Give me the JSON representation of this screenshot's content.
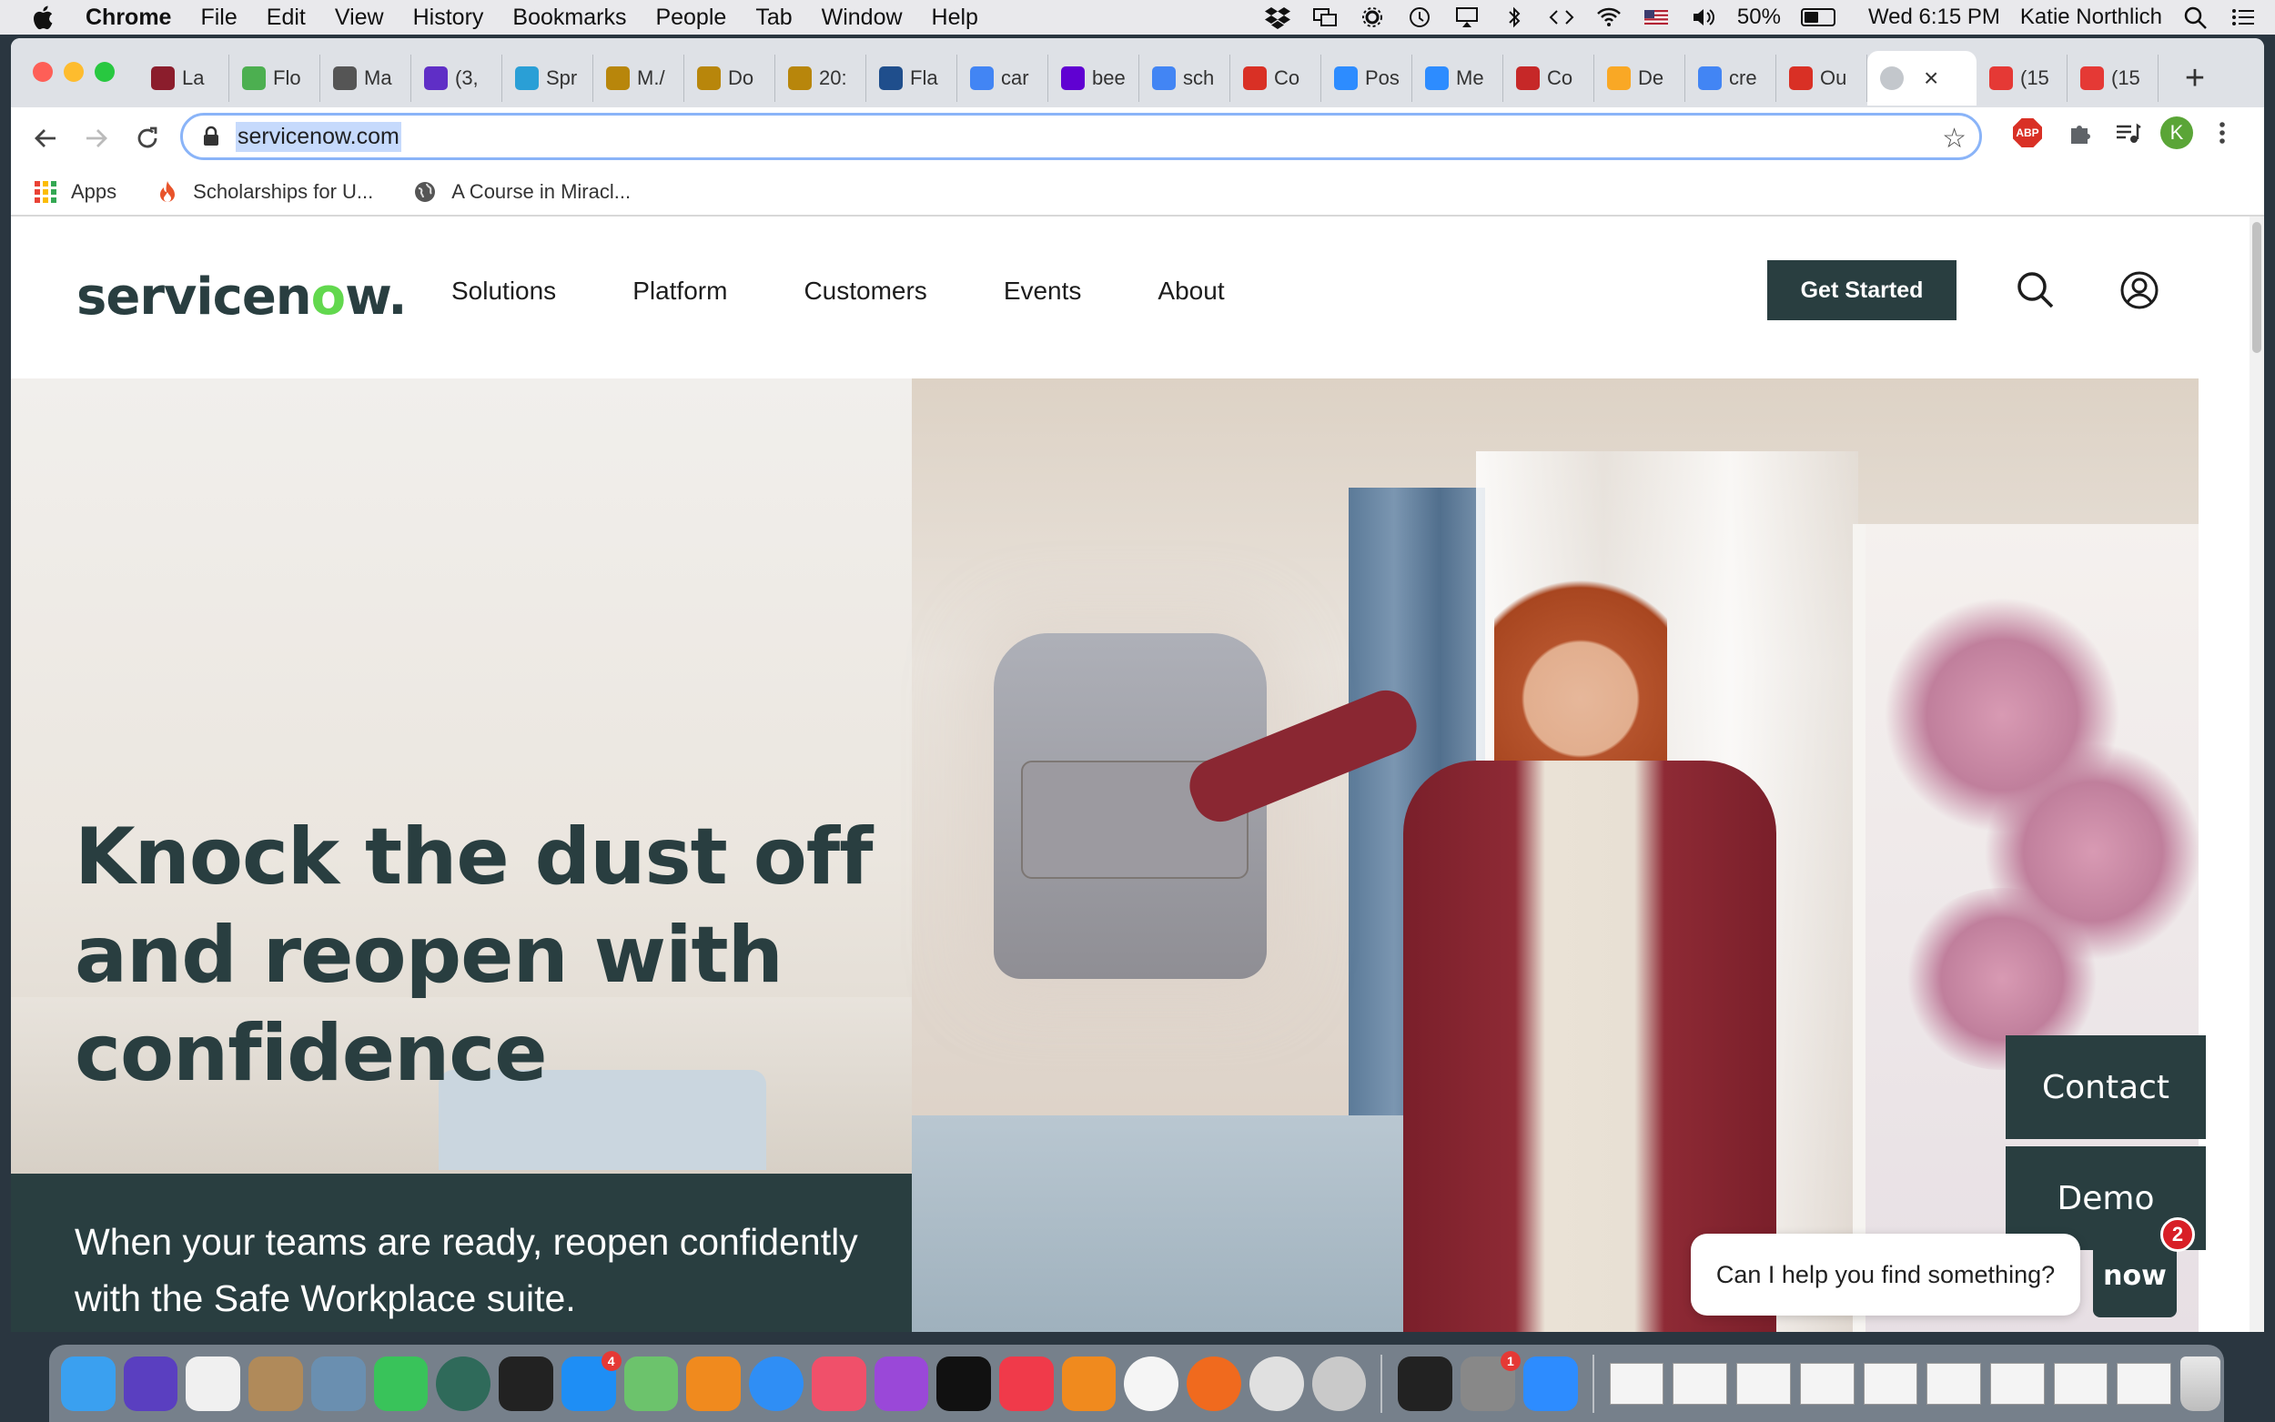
{
  "menubar": {
    "app_name": "Chrome",
    "items": [
      "File",
      "Edit",
      "View",
      "History",
      "Bookmarks",
      "People",
      "Tab",
      "Window",
      "Help"
    ],
    "battery_percent": "50%",
    "clock": "Wed 6:15 PM",
    "user": "Katie Northlich"
  },
  "tabs": [
    {
      "label": "La",
      "color": "#8b1d2c"
    },
    {
      "label": "Flo",
      "color": "#4caf50"
    },
    {
      "label": "Ma",
      "color": "#555555"
    },
    {
      "label": "(3,",
      "color": "#5f2ec6"
    },
    {
      "label": "Spr",
      "color": "#2a9fd6"
    },
    {
      "label": "M./",
      "color": "#b8860b"
    },
    {
      "label": "Do",
      "color": "#b8860b"
    },
    {
      "label": "20:",
      "color": "#b8860b"
    },
    {
      "label": "Fla",
      "color": "#1f4e8c"
    },
    {
      "label": "car",
      "color": "#4285f4"
    },
    {
      "label": "bee",
      "color": "#6001d2"
    },
    {
      "label": "sch",
      "color": "#4285f4"
    },
    {
      "label": "Co",
      "color": "#d93025"
    },
    {
      "label": "Pos",
      "color": "#2d8cff"
    },
    {
      "label": "Me",
      "color": "#2d8cff"
    },
    {
      "label": "Co",
      "color": "#c62828"
    },
    {
      "label": "De",
      "color": "#f9a825"
    },
    {
      "label": "cre",
      "color": "#4285f4"
    },
    {
      "label": "Ou",
      "color": "#d93025"
    }
  ],
  "active_tab": {
    "label": "",
    "close": "×"
  },
  "tabs_after": [
    {
      "label": "(15",
      "color": "#e53935"
    },
    {
      "label": "(15",
      "color": "#e53935"
    }
  ],
  "new_tab": "+",
  "address_bar": {
    "url": "servicenow.com"
  },
  "extensions": {
    "abp": "ABP",
    "profile": "K"
  },
  "bookmarks": [
    {
      "label": "Apps"
    },
    {
      "label": "Scholarships for U..."
    },
    {
      "label": "A Course in Miracl..."
    }
  ],
  "site": {
    "logo": {
      "pre": "servicen",
      "o": "o",
      "post": "w."
    },
    "nav": [
      "Solutions",
      "Platform",
      "Customers",
      "Events",
      "About"
    ],
    "cta": "Get Started",
    "headline": "Knock the dust off and reopen with confidence",
    "subtext": "When your teams are ready, reopen confidently with the Safe Workplace suite.",
    "side_buttons": {
      "contact": "Contact",
      "demo": "Demo"
    },
    "chat": {
      "prompt": "Can I help you find something?",
      "bot_label": "now",
      "badge": "2"
    },
    "brand_color": "#293e40",
    "accent_color": "#62d84e"
  },
  "dock": {
    "icons": [
      "finder",
      "imovie",
      "pages",
      "contacts",
      "preview",
      "facetime",
      "time-machine",
      "activity-monitor",
      "app-store",
      "maps",
      "vlc",
      "safari",
      "music",
      "podcasts",
      "tv",
      "news",
      "books",
      "photos",
      "firefox",
      "chrome",
      "disk-utility",
      "terminal",
      "system-preferences",
      "zoom"
    ],
    "badges": {
      "app-store": "4",
      "system-preferences": "1"
    }
  }
}
